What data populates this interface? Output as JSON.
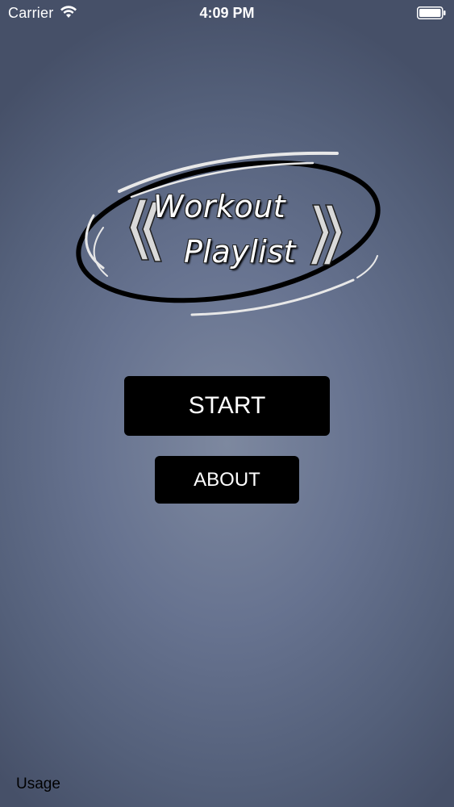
{
  "status_bar": {
    "carrier": "Carrier",
    "time": "4:09 PM",
    "wifi_icon": "wifi-icon",
    "battery_icon": "battery-full-icon"
  },
  "logo": {
    "line1": "Workout",
    "line2": "Playlist"
  },
  "buttons": {
    "start_label": "START",
    "about_label": "ABOUT"
  },
  "footer": {
    "usage_label": "Usage"
  },
  "colors": {
    "background_center": "#7d889f",
    "background_edge": "#465068",
    "button_bg": "#000000",
    "button_text": "#ffffff"
  }
}
